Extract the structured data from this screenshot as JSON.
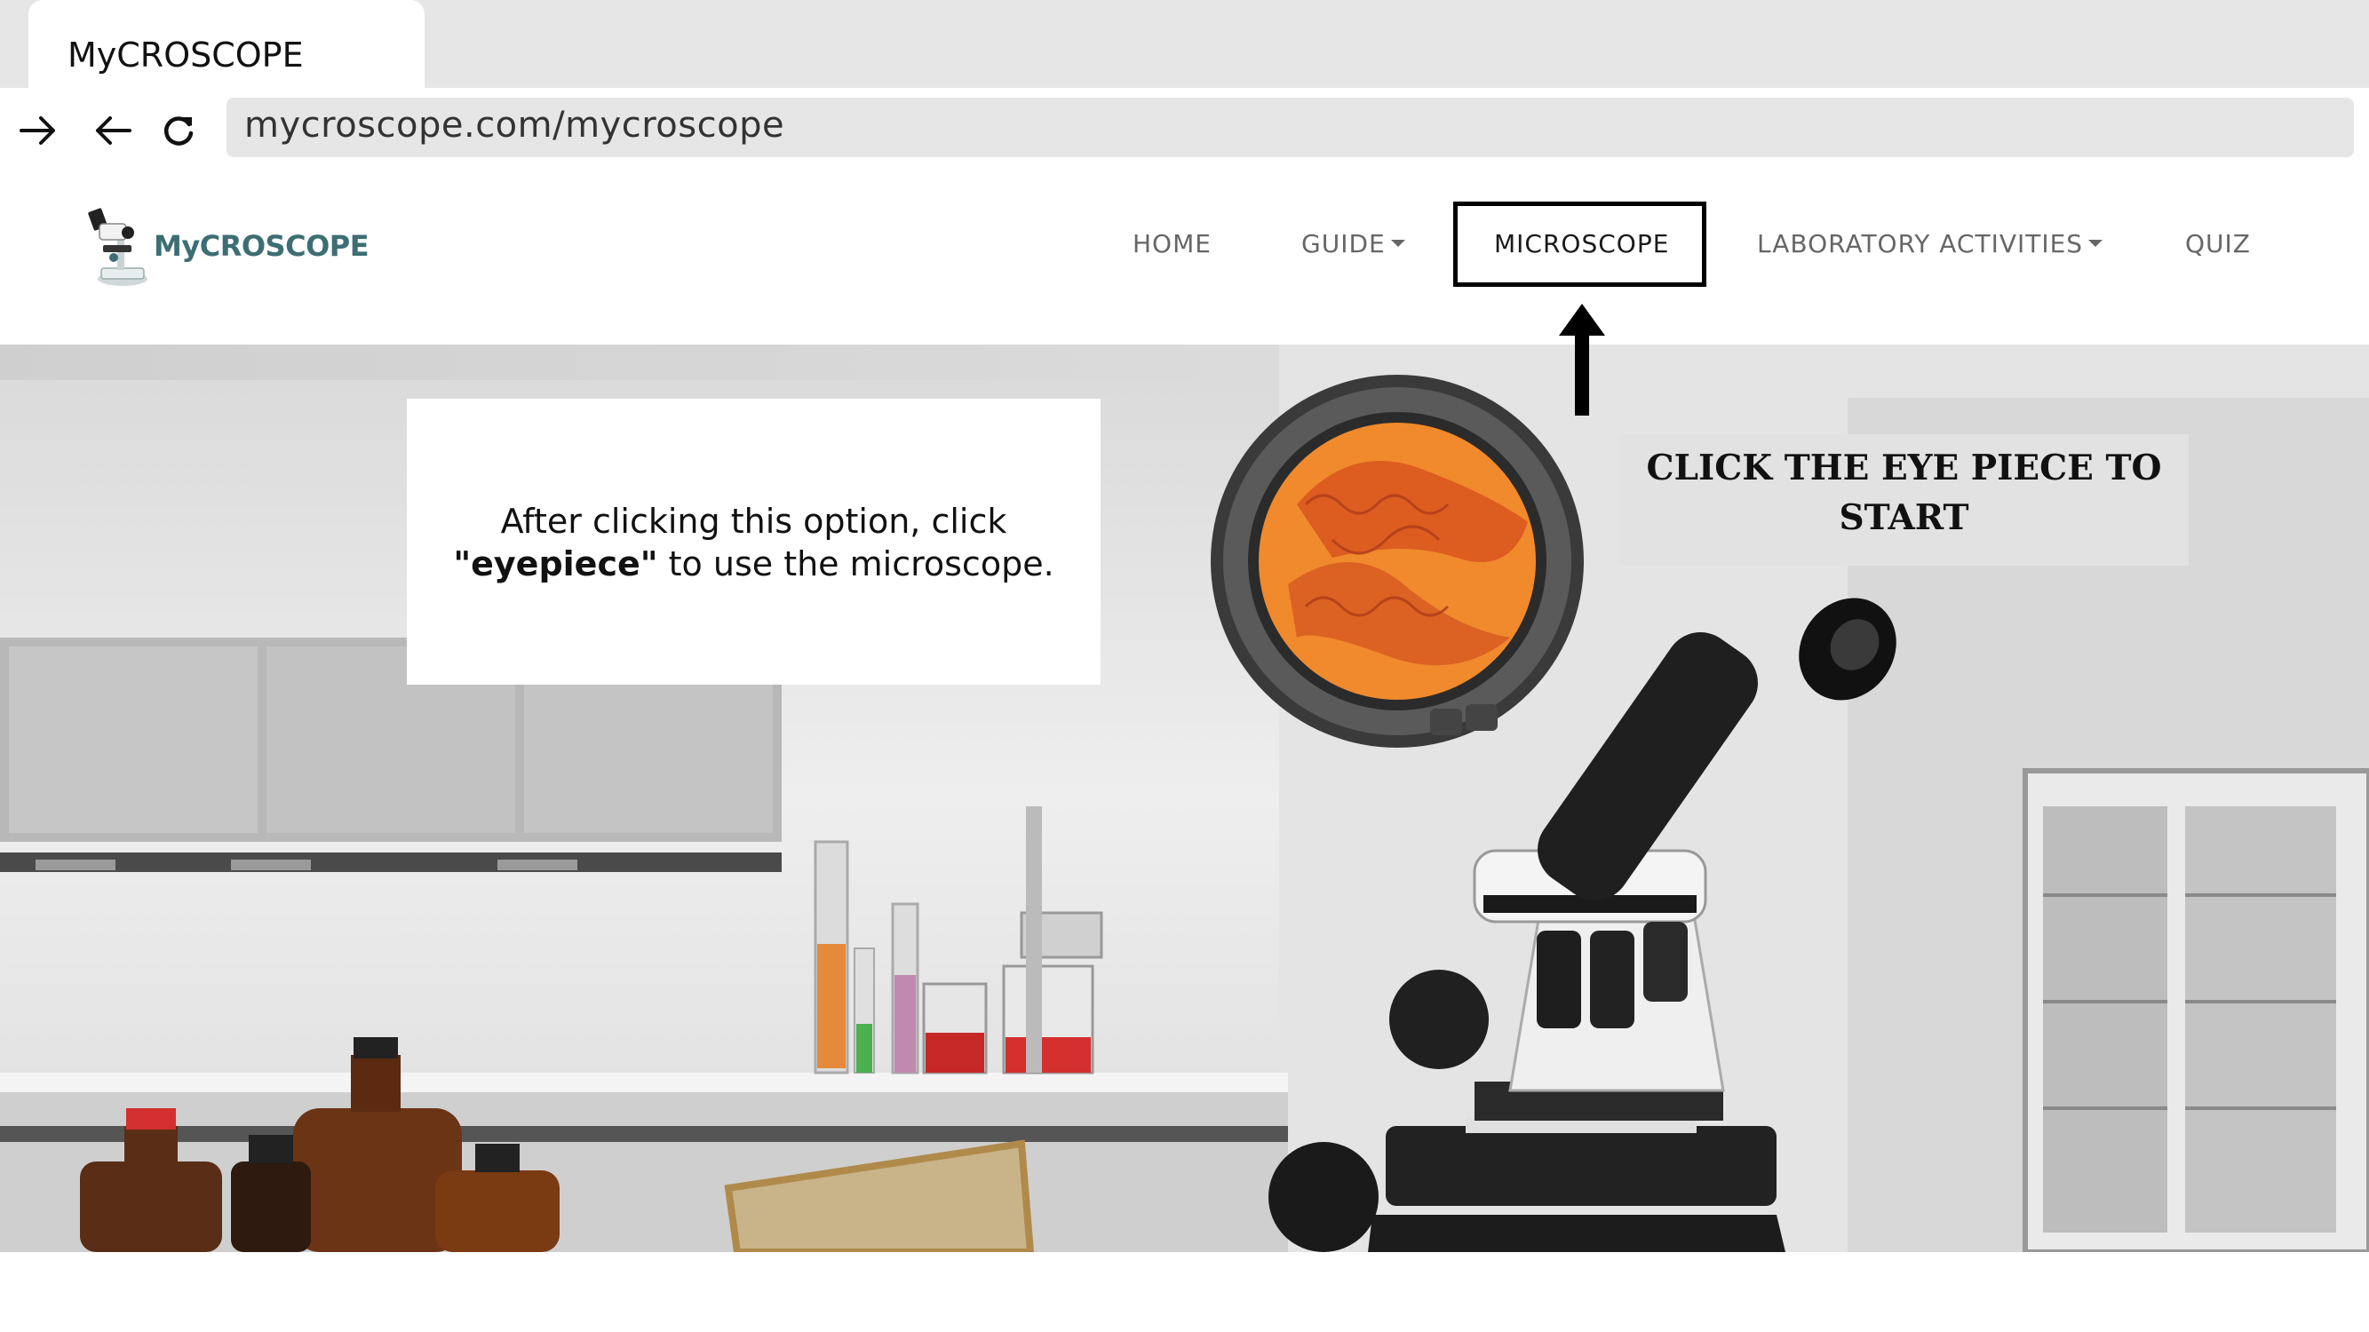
{
  "browser": {
    "tab_title": "MyCROSCOPE",
    "url": "mycroscope.com/mycroscope",
    "buttons": [
      "forward-arrow-icon",
      "back-arrow-icon",
      "reload-icon"
    ]
  },
  "site": {
    "logo_text": "MyCROSCOPE",
    "nav": {
      "home": "HOME",
      "guide": "GUIDE",
      "microscope": "MICROSCOPE",
      "lab": "LABORATORY ACTIVITIES",
      "quiz": "QUIZ"
    }
  },
  "annotation": {
    "instruction_line1": "After clicking this option, click",
    "instruction_bold": "\"eyepiece\"",
    "instruction_line2_rest": " to use the microscope.",
    "cta_line1": "CLICK THE EYE PIECE TO",
    "cta_line2": "START"
  },
  "colors": {
    "chrome_gray": "#e6e6e6",
    "logo_teal": "#3d6e74",
    "nav_gray": "#666666",
    "highlight_border": "#000000",
    "specimen_orange": "#f08a2c"
  }
}
